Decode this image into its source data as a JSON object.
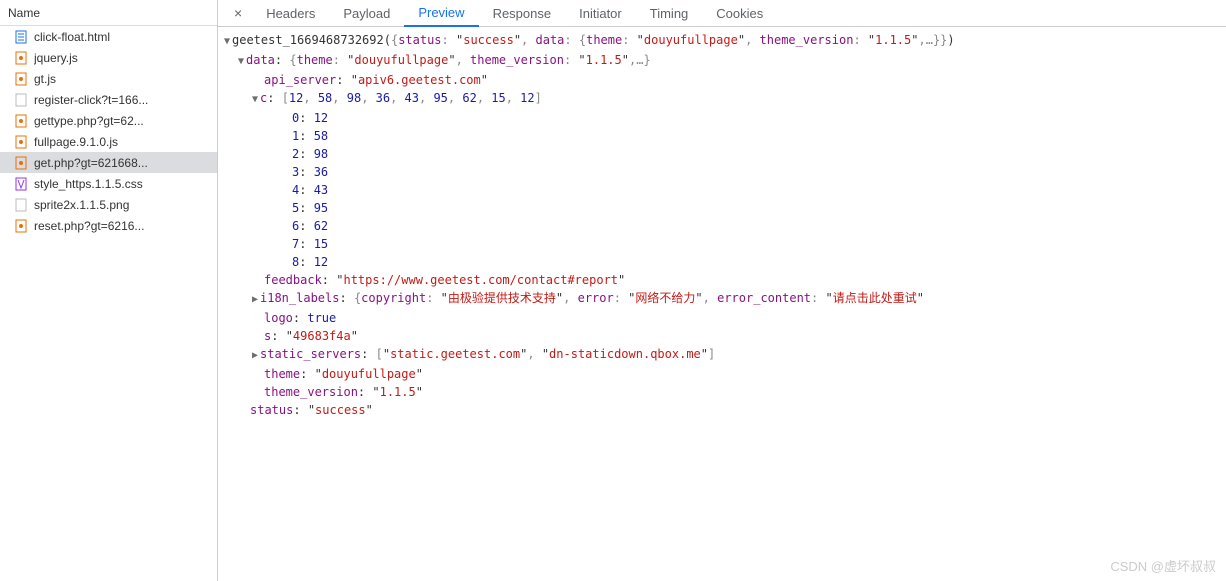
{
  "sidebar": {
    "header": "Name",
    "files": [
      {
        "name": "click-float.html",
        "icon": "doc-blue"
      },
      {
        "name": "jquery.js",
        "icon": "js"
      },
      {
        "name": "gt.js",
        "icon": "js"
      },
      {
        "name": "register-click?t=166...",
        "icon": "blank"
      },
      {
        "name": "gettype.php?gt=62...",
        "icon": "js"
      },
      {
        "name": "fullpage.9.1.0.js",
        "icon": "js"
      },
      {
        "name": "get.php?gt=621668...",
        "icon": "js",
        "selected": true
      },
      {
        "name": "style_https.1.1.5.css",
        "icon": "css"
      },
      {
        "name": "sprite2x.1.1.5.png",
        "icon": "blank"
      },
      {
        "name": "reset.php?gt=6216...",
        "icon": "js"
      }
    ]
  },
  "tabs": {
    "close": "×",
    "items": [
      {
        "label": "Headers"
      },
      {
        "label": "Payload"
      },
      {
        "label": "Preview",
        "active": true
      },
      {
        "label": "Response"
      },
      {
        "label": "Initiator"
      },
      {
        "label": "Timing"
      },
      {
        "label": "Cookies"
      }
    ]
  },
  "preview": {
    "callback_name": "geetest_1669468732692",
    "summary_status_k": "status",
    "summary_status_v": "success",
    "summary_data_k": "data",
    "summary_theme_k": "theme",
    "summary_theme_v": "douyufullpage",
    "summary_tv_k": "theme_version",
    "summary_tv_v": "1.1.5",
    "ellipsis": ",…",
    "data_k": "data",
    "api_server_k": "api_server",
    "api_server_v": "apiv6.geetest.com",
    "c_k": "c",
    "c_values": [
      12,
      58,
      98,
      36,
      43,
      95,
      62,
      15,
      12
    ],
    "feedback_k": "feedback",
    "feedback_v": "https://www.geetest.com/contact#report",
    "i18n_k": "i18n_labels",
    "i18n_copyright_k": "copyright",
    "i18n_copyright_v": "由极验提供技术支持",
    "i18n_error_k": "error",
    "i18n_error_v": "网络不给力",
    "i18n_errorc_k": "error_content",
    "i18n_errorc_v": "请点击此处重试",
    "logo_k": "logo",
    "logo_v": "true",
    "s_k": "s",
    "s_v": "49683f4a",
    "static_k": "static_servers",
    "static_v0": "static.geetest.com",
    "static_v1": "dn-staticdown.qbox.me",
    "theme_k": "theme",
    "theme_v": "douyufullpage",
    "tv_k": "theme_version",
    "tv_v": "1.1.5",
    "status_k": "status",
    "status_v": "success"
  },
  "watermark": "CSDN @虚坏叔叔"
}
